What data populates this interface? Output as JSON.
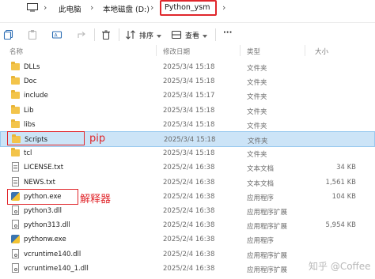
{
  "address_bar": {
    "breadcrumbs": [
      "此电脑",
      "本地磁盘 (D:)",
      "Python_ysm"
    ],
    "icon": "monitor-icon"
  },
  "toolbar": {
    "sort_label": "排序",
    "view_label": "查看",
    "more_label": "···",
    "icons": [
      "copy-icon",
      "paste-icon",
      "rename-icon",
      "share-icon",
      "delete-icon",
      "sort-icon",
      "view-icon"
    ]
  },
  "columns": {
    "name": "名称",
    "date": "修改日期",
    "type": "类型",
    "size": "大小"
  },
  "rows": [
    {
      "name": "DLLs",
      "date": "2025/3/4 15:18",
      "type": "文件夹",
      "size": "",
      "icon": "folder-icon"
    },
    {
      "name": "Doc",
      "date": "2025/3/4 15:18",
      "type": "文件夹",
      "size": "",
      "icon": "folder-icon"
    },
    {
      "name": "include",
      "date": "2025/3/4 15:17",
      "type": "文件夹",
      "size": "",
      "icon": "folder-icon"
    },
    {
      "name": "Lib",
      "date": "2025/3/4 15:18",
      "type": "文件夹",
      "size": "",
      "icon": "folder-icon"
    },
    {
      "name": "libs",
      "date": "2025/3/4 15:18",
      "type": "文件夹",
      "size": "",
      "icon": "folder-icon"
    },
    {
      "name": "Scripts",
      "date": "2025/3/4 15:18",
      "type": "文件夹",
      "size": "",
      "icon": "folder-icon"
    },
    {
      "name": "tcl",
      "date": "2025/3/4 15:18",
      "type": "文件夹",
      "size": "",
      "icon": "folder-icon"
    },
    {
      "name": "LICENSE.txt",
      "date": "2025/2/4 16:38",
      "type": "文本文档",
      "size": "34 KB",
      "icon": "text-file-icon"
    },
    {
      "name": "NEWS.txt",
      "date": "2025/2/4 16:38",
      "type": "文本文档",
      "size": "1,561 KB",
      "icon": "text-file-icon"
    },
    {
      "name": "python.exe",
      "date": "2025/2/4 16:38",
      "type": "应用程序",
      "size": "104 KB",
      "icon": "python-icon"
    },
    {
      "name": "python3.dll",
      "date": "2025/2/4 16:38",
      "type": "应用程序扩展",
      "size": "",
      "icon": "dll-file-icon"
    },
    {
      "name": "python313.dll",
      "date": "2025/2/4 16:38",
      "type": "应用程序扩展",
      "size": "5,954 KB",
      "icon": "dll-file-icon"
    },
    {
      "name": "pythonw.exe",
      "date": "2025/2/4 16:38",
      "type": "应用程序",
      "size": "",
      "icon": "python-icon"
    },
    {
      "name": "vcruntime140.dll",
      "date": "2025/2/4 16:38",
      "type": "应用程序扩展",
      "size": "",
      "icon": "dll-file-icon"
    },
    {
      "name": "vcruntime140_1.dll",
      "date": "2025/2/4 16:38",
      "type": "应用程序扩展",
      "size": "",
      "icon": "dll-file-icon"
    }
  ],
  "annotations": {
    "pip_label": "pip",
    "interpreter_label": "解释器"
  },
  "watermark": "知乎 @Coffee",
  "colors": {
    "annotation_red": "#e0262b",
    "selection_bg": "#cce4f7"
  }
}
